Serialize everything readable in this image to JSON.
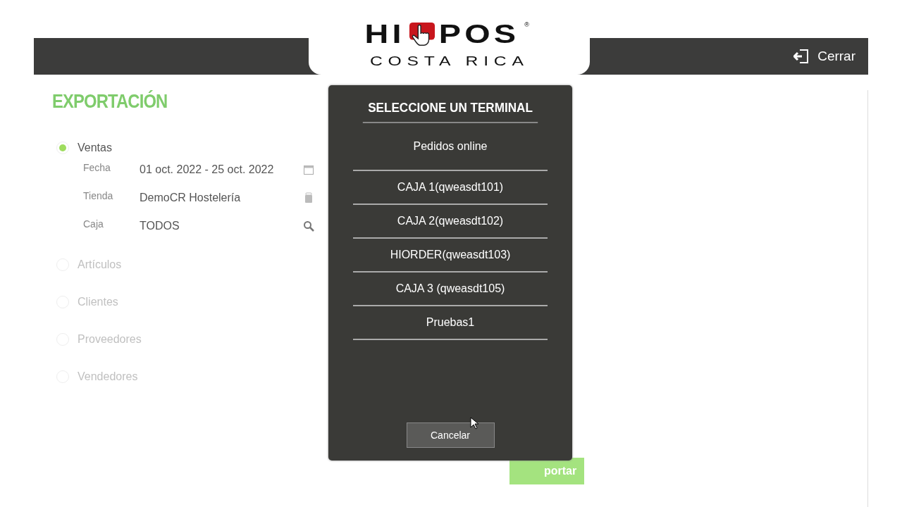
{
  "logo": {
    "word_start": "HI",
    "word_end": "POS",
    "registered": "®",
    "subtitle": "COSTA RICA"
  },
  "header": {
    "logout_label": "Cerrar"
  },
  "page_title": "EXPORTACIÓN",
  "export_types": [
    {
      "label": "Ventas",
      "selected": true,
      "fields": [
        {
          "label": "Fecha",
          "value": "01 oct. 2022 - 25 oct. 2022",
          "kind": "calendar"
        },
        {
          "label": "Tienda",
          "value": "DemoCR Hostelería",
          "kind": "store"
        },
        {
          "label": "Caja",
          "value": "TODOS",
          "kind": "search"
        }
      ]
    },
    {
      "label": "Artículos",
      "selected": false
    },
    {
      "label": "Clientes",
      "selected": false
    },
    {
      "label": "Proveedores",
      "selected": false
    },
    {
      "label": "Vendedores",
      "selected": false
    }
  ],
  "export_button": "portar",
  "dialog": {
    "title": "SELECCIONE UN TERMINAL",
    "options": [
      "Pedidos online",
      "CAJA 1(qweasdt101)",
      "CAJA 2(qweasdt102)",
      "HIORDER(qweasdt103)",
      "CAJA 3 (qweasdt105)",
      "Pruebas1"
    ],
    "cancel": "Cancelar"
  }
}
